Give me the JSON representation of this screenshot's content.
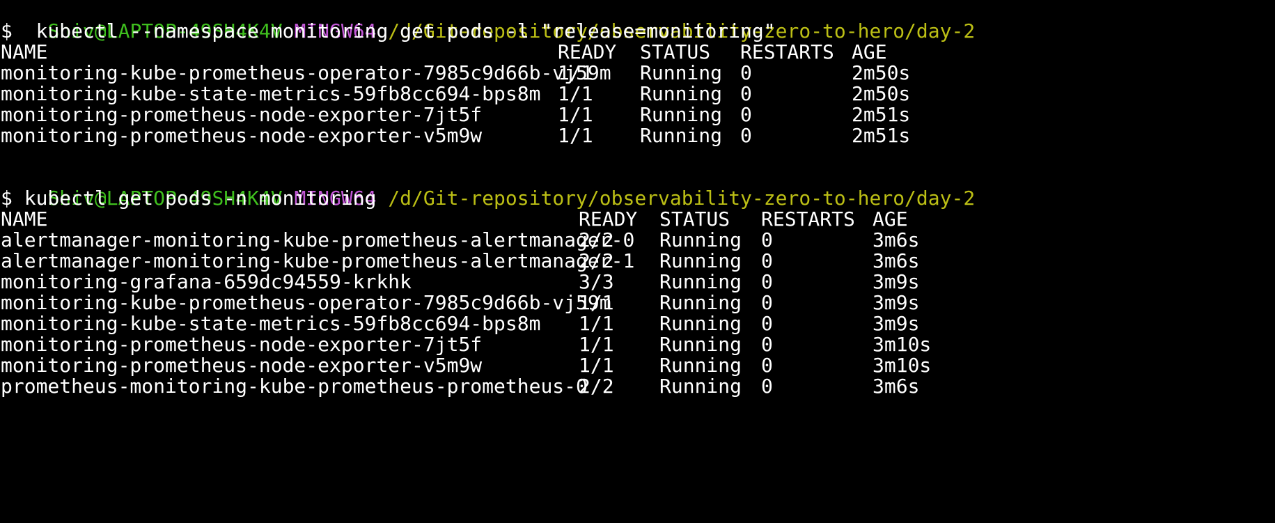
{
  "colors": {
    "background": "#000000",
    "text": "#ffffff",
    "prompt_user": "#3fbf1e",
    "prompt_env": "#c257d6",
    "prompt_path": "#bcbf15"
  },
  "blocks": [
    {
      "prompt": {
        "user": "Shiv@LAPTOP-49SH4K4V",
        "env": "MINGW64",
        "path": "/d/Git-repository/observability-zero-to-hero/day-2"
      },
      "command": "$  kubectl --namespace monitoring get pods -l \"release=monitoring\"",
      "headers": [
        "NAME",
        "READY",
        "STATUS",
        "RESTARTS",
        "AGE"
      ],
      "rows": [
        [
          "monitoring-kube-prometheus-operator-7985c9d66b-vj59m",
          "1/1",
          "Running",
          "0",
          "2m50s"
        ],
        [
          "monitoring-kube-state-metrics-59fb8cc694-bps8m",
          "1/1",
          "Running",
          "0",
          "2m50s"
        ],
        [
          "monitoring-prometheus-node-exporter-7jt5f",
          "1/1",
          "Running",
          "0",
          "2m51s"
        ],
        [
          "monitoring-prometheus-node-exporter-v5m9w",
          "1/1",
          "Running",
          "0",
          "2m51s"
        ]
      ]
    },
    {
      "prompt": {
        "user": "Shiv@LAPTOP-49SH4K4V",
        "env": "MINGW64",
        "path": "/d/Git-repository/observability-zero-to-hero/day-2"
      },
      "command": "$ kubectl get pods -n monitoring",
      "headers": [
        "NAME",
        "READY",
        "STATUS",
        "RESTARTS",
        "AGE"
      ],
      "rows": [
        [
          "alertmanager-monitoring-kube-prometheus-alertmanager-0",
          "2/2",
          "Running",
          "0",
          "3m6s"
        ],
        [
          "alertmanager-monitoring-kube-prometheus-alertmanager-1",
          "2/2",
          "Running",
          "0",
          "3m6s"
        ],
        [
          "monitoring-grafana-659dc94559-krkhk",
          "3/3",
          "Running",
          "0",
          "3m9s"
        ],
        [
          "monitoring-kube-prometheus-operator-7985c9d66b-vj59m",
          "1/1",
          "Running",
          "0",
          "3m9s"
        ],
        [
          "monitoring-kube-state-metrics-59fb8cc694-bps8m",
          "1/1",
          "Running",
          "0",
          "3m9s"
        ],
        [
          "monitoring-prometheus-node-exporter-7jt5f",
          "1/1",
          "Running",
          "0",
          "3m10s"
        ],
        [
          "monitoring-prometheus-node-exporter-v5m9w",
          "1/1",
          "Running",
          "0",
          "3m10s"
        ],
        [
          "prometheus-monitoring-kube-prometheus-prometheus-0",
          "2/2",
          "Running",
          "0",
          "3m6s"
        ]
      ]
    }
  ]
}
